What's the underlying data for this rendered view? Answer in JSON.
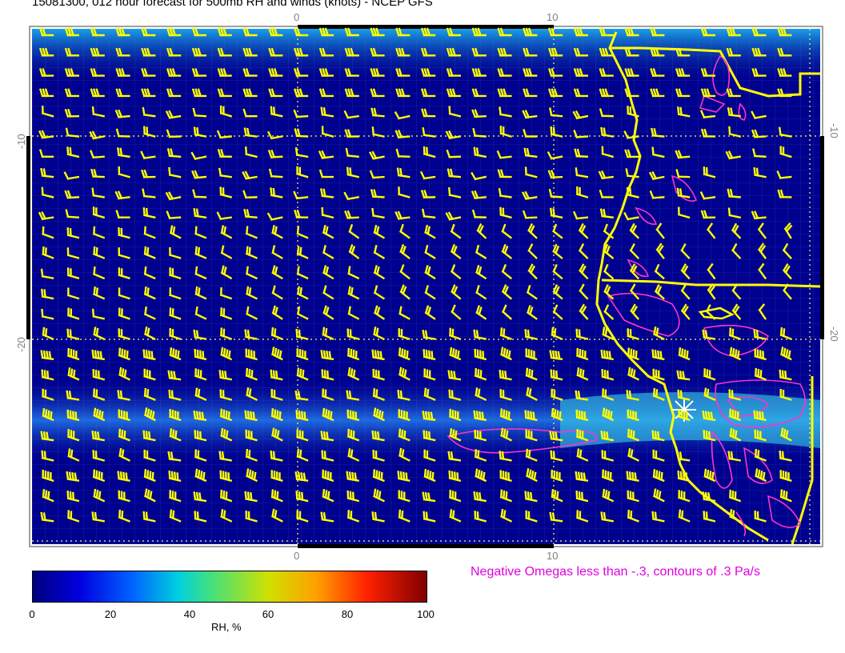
{
  "title": "15081300, 012 hour forecast for 500mb RH and winds (knots) - NCEP GFS",
  "axis": {
    "top_ticks": [
      "0",
      "10"
    ],
    "bottom_ticks": [
      "0",
      "10"
    ],
    "left_ticks": [
      "-10",
      "-20"
    ],
    "right_ticks": [
      "-10",
      "-20"
    ]
  },
  "legend": {
    "omega_note": "Negative Omegas less than -.3, contours of .3 Pa/s",
    "colorbar_ticks": [
      "0",
      "20",
      "40",
      "60",
      "80",
      "100"
    ],
    "colorbar_label": "RH, %"
  },
  "colors": {
    "ocean_base": "#00008e",
    "moist_band": "#1e6be0",
    "barb": "#ffff00",
    "coast": "#ffff00",
    "omega_contour": "#ff33cc",
    "grid_dotted": "#ffff66"
  }
}
